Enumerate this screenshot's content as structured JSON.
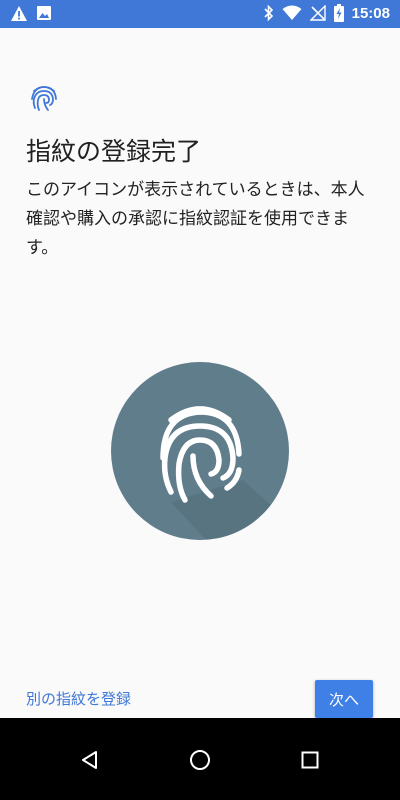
{
  "status_bar": {
    "time": "15:08",
    "left_icons": [
      "warning-icon",
      "image-icon"
    ],
    "right_icons": [
      "bluetooth-icon",
      "wifi-icon",
      "signal-off-icon",
      "battery-charging-icon"
    ],
    "color": "#3f78d6"
  },
  "main": {
    "title": "指紋の登録完了",
    "description": "このアイコンが表示されているときは、本人確認や購入の承認に指紋認証を使用できます。",
    "small_icon": "fingerprint-icon",
    "large_icon": "fingerprint-circle-icon",
    "accent_color": "#3f78d6",
    "circle_color": "#607d8b"
  },
  "footer": {
    "add_another_label": "別の指紋を登録",
    "next_label": "次へ"
  },
  "nav_bar": {
    "buttons": [
      "back-icon",
      "home-icon",
      "recents-icon"
    ]
  }
}
